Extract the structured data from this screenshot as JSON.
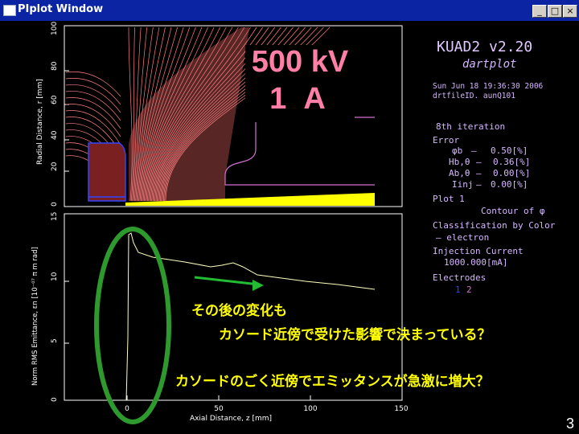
{
  "window": {
    "title": "PIplot Window",
    "minimize": "_",
    "maximize": "□",
    "close": "×"
  },
  "top_plot": {
    "ylabel": "Radial Distance, r [mm]",
    "yticks": [
      "0",
      "20",
      "40",
      "60",
      "80",
      "100"
    ]
  },
  "bottom_plot": {
    "ylabel": "Norm RMS Emittance, εn [10⁻⁰⁷ π m rad]",
    "yticks": [
      "0",
      "5",
      "10",
      "15"
    ],
    "xticks": [
      "0",
      "50",
      "100",
      "150"
    ],
    "xlabel": "Axial Distance, z [mm]"
  },
  "overlay": {
    "voltage": "500 kV",
    "current": "1 A"
  },
  "program": {
    "name": "KUAD2 v2.20",
    "subtitle": "dartplot"
  },
  "run_info": {
    "date": "Sun Jun 18 19:36:30 2006",
    "file": "drtfileID. aunQ101"
  },
  "iteration": "8th iteration",
  "errors": {
    "label": "Error",
    "rows": [
      {
        "sym": "φb",
        "dash": "–",
        "value": "0.50[%]"
      },
      {
        "sym": "Hb,θ",
        "dash": "–",
        "value": "0.36[%]"
      },
      {
        "sym": "Ab,θ",
        "dash": "–",
        "value": "0.00[%]"
      },
      {
        "sym": "Iinj",
        "dash": "–",
        "value": "0.00[%]"
      }
    ]
  },
  "plot_info": {
    "line1": "Plot 1",
    "line2": "Contour of φ"
  },
  "classification": {
    "label": "Classification by Color",
    "item": "— electron"
  },
  "injection": {
    "label": "Injection Current",
    "value": "1000.000[mA]"
  },
  "electrodes": {
    "label": "Electrodes",
    "values": [
      "1",
      "2"
    ]
  },
  "annotations": {
    "line1": "その後の変化も",
    "line2": "カソード近傍で受けた影響で決まっている？",
    "line3": "カソードのごく近傍でエミッタンスが急激に増大？"
  },
  "page_number": "3",
  "colors": {
    "titlebar": "#0a24a4",
    "contours": "#ff8080",
    "beam": "#ffff00",
    "electrode": "#d070d0",
    "annotation": "#ffff00",
    "ellipse": "#2e9a2e",
    "arrow": "#22bb33"
  }
}
